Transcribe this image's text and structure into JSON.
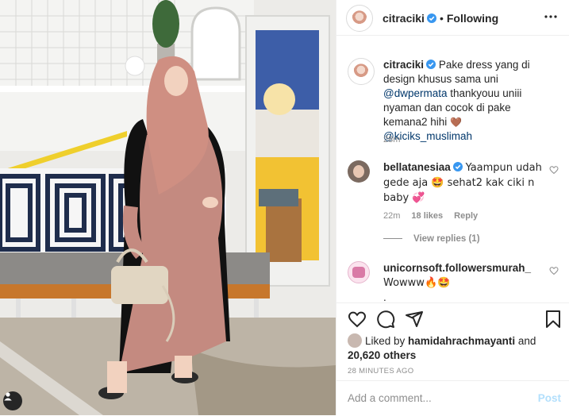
{
  "post": {
    "author": "citraciki",
    "follow_status": "Following",
    "separator": "•"
  },
  "caption": {
    "username": "citraciki",
    "text_1": "Pake dress yang di design khusus sama uni ",
    "mention_1": "@dwpermata",
    "text_2": " thankyouu uniii nyaman dan cocok di pake kemana2 hihi ",
    "emoji_1": "🤎",
    "mention_2": "@kiciks_muslimah",
    "time": "28m"
  },
  "comments": [
    {
      "username": "bellatanesiaa",
      "verified": true,
      "text": "Yaampun udah gede aja 🤩 sehat2 kak ciki n baby 💞",
      "time": "22m",
      "likes": "18 likes",
      "reply": "Reply",
      "view_replies": "View replies (1)"
    },
    {
      "username": "unicornsoft.followersmurah_",
      "verified": false,
      "text": "Wowww🔥🤩",
      "extra": "."
    }
  ],
  "actions": {
    "liked_prefix": "Liked by ",
    "liked_user": "hamidahrachmayanti",
    "liked_and": " and",
    "liked_others": "20,620 others",
    "time_ago": "28 MINUTES AGO"
  },
  "composer": {
    "placeholder": "Add a comment...",
    "post_label": "Post"
  },
  "colors": {
    "verified": "#3897f0",
    "mention": "#00376b",
    "post_disabled": "#b2dffc",
    "secondary_text": "#8e8e8e"
  },
  "icons": [
    "verified-badge-icon",
    "more-options-icon",
    "heart-icon",
    "comment-icon",
    "share-icon",
    "bookmark-icon",
    "user-tag-icon"
  ]
}
